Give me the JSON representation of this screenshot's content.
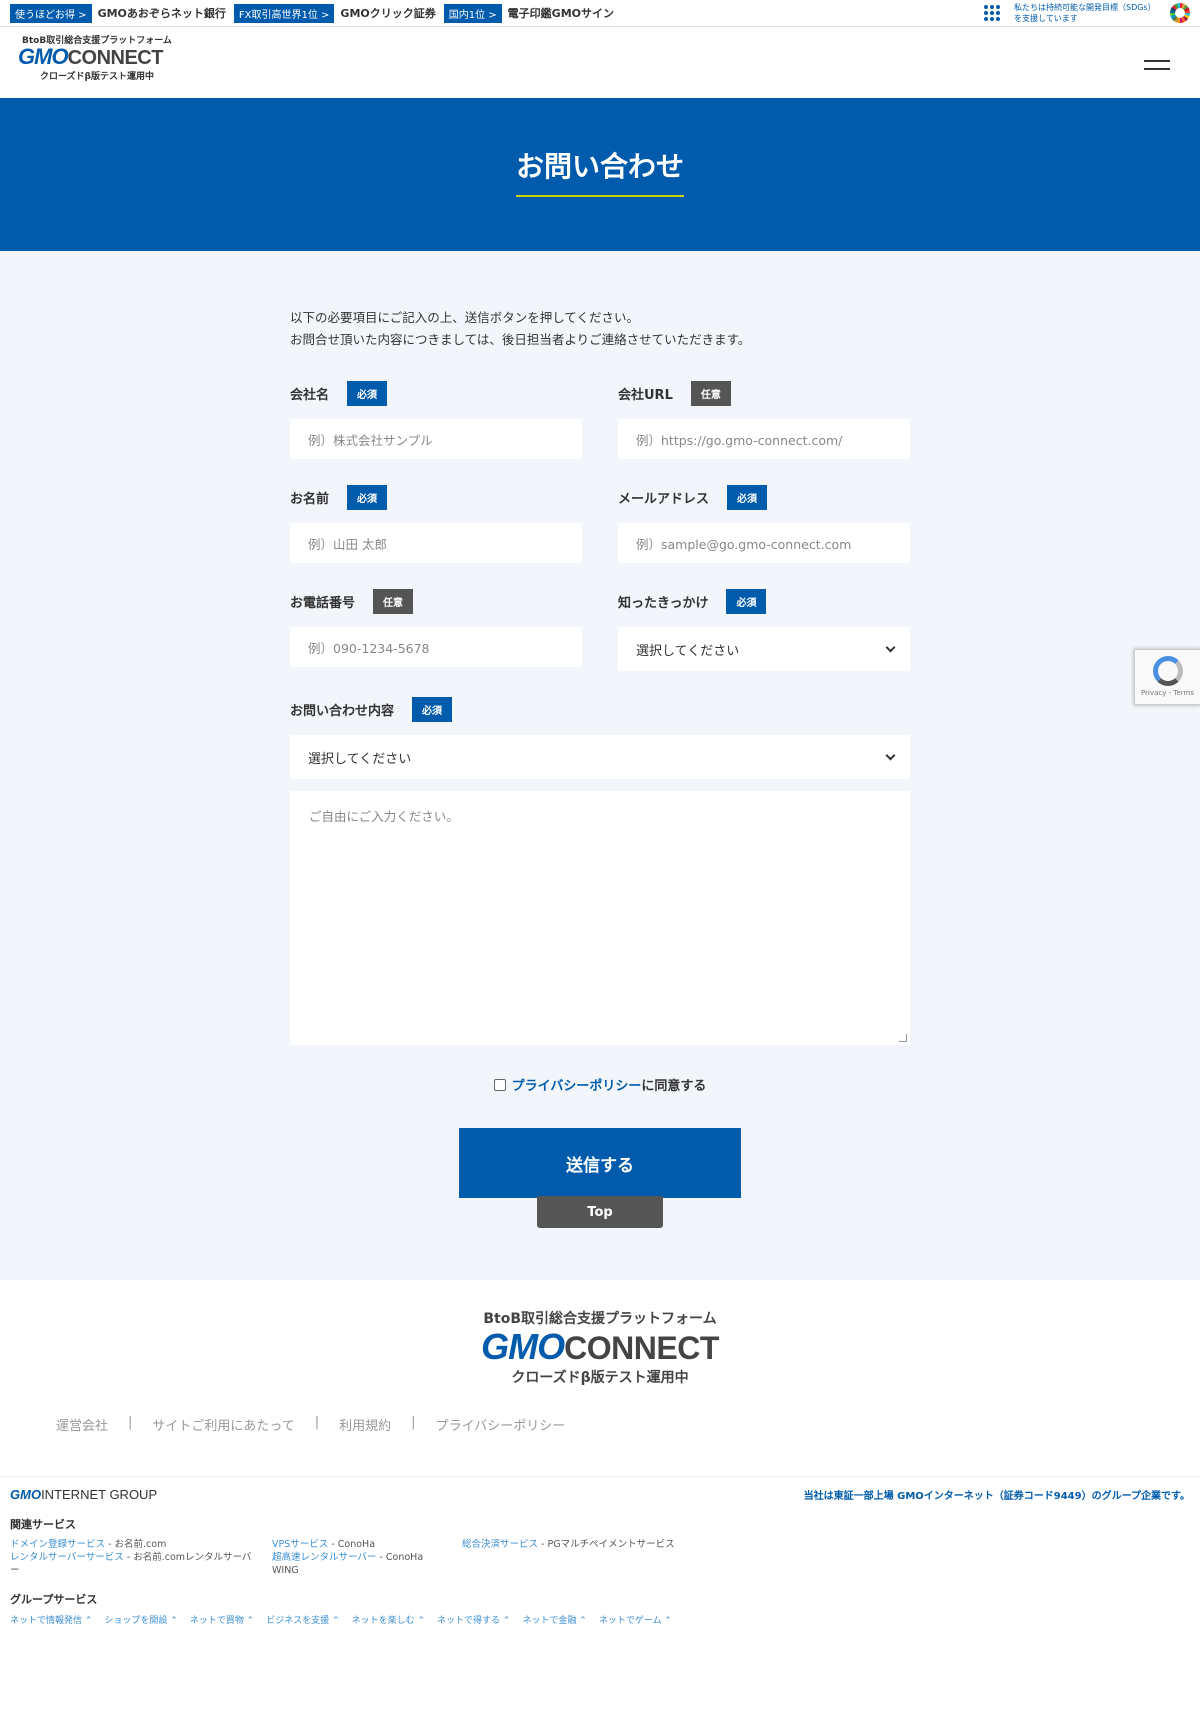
{
  "topbar": {
    "items": [
      {
        "badge": "使うほどお得 >",
        "text": "GMOあおぞらネット銀行"
      },
      {
        "badge": "FX取引高世界1位 >",
        "text": "GMOクリック証券"
      },
      {
        "badge": "国内1位 >",
        "text": "電子印鑑GMOサイン"
      }
    ],
    "sdgs_line1": "私たちは持続可能な開発目標（SDGs）",
    "sdgs_line2": "を支援しています"
  },
  "header": {
    "logo_tagline": "BtoB取引総合支援プラットフォーム",
    "logo_gmo": "GMO",
    "logo_connect": "CONNECT",
    "logo_sub": "クローズドβ版テスト運用中"
  },
  "hero": {
    "title": "お問い合わせ"
  },
  "form": {
    "intro_line1": "以下の必要項目にご記入の上、送信ボタンを押してください。",
    "intro_line2": "お問合せ頂いた内容につきましては、後日担当者よりご連絡させていただきます。",
    "required": "必須",
    "optional": "任意",
    "company_label": "会社名",
    "company_placeholder": "例）株式会社サンプル",
    "url_label": "会社URL",
    "url_placeholder": "例）https://go.gmo-connect.com/",
    "name_label": "お名前",
    "name_placeholder": "例）山田 太郎",
    "email_label": "メールアドレス",
    "email_placeholder": "例）sample@go.gmo-connect.com",
    "phone_label": "お電話番号",
    "phone_placeholder": "例）090-1234-5678",
    "source_label": "知ったきっかけ",
    "source_value": "選択してください",
    "inquiry_label": "お問い合わせ内容",
    "inquiry_value": "選択してください",
    "message_placeholder": "ご自由にご入力ください。",
    "agree_link": "プライバシーポリシー",
    "agree_text": "に同意する",
    "submit": "送信する",
    "top": "Top",
    "recaptcha": "Privacy - Terms"
  },
  "footer": {
    "tagline": "BtoB取引総合支援プラットフォーム",
    "logo_gmo": "GMO",
    "logo_connect": "CONNECT",
    "sub": "クローズドβ版テスト運用中",
    "links": [
      "運営会社",
      "サイトご利用にあたって",
      "利用規約",
      "プライバシーポリシー"
    ]
  },
  "group": {
    "logo_gmo": "GMO",
    "logo_text": "INTERNET GROUP",
    "note": "当社は東証一部上場 GMOインターネット（証券コード9449）のグループ企業です。",
    "related_title": "関連サービス",
    "col1_link1": "ドメイン登録サービス",
    "col1_name1": "お名前.com",
    "col1_link2": "レンタルサーバーサービス",
    "col1_name2": "お名前.comレンタルサーバー",
    "col2_link1": "VPSサービス",
    "col2_name1": "ConoHa",
    "col2_link2": "超高速レンタルサーバー",
    "col2_name2": "ConoHa WING",
    "col3_link1": "総合決済サービス",
    "col3_name1": "PGマルチペイメントサービス",
    "group_title": "グループサービス",
    "group_items": [
      "ネットで情報発信 ⌃",
      "ショップを開設 ⌃",
      "ネットで買物 ⌃",
      "ビジネスを支援 ⌃",
      "ネットを楽しむ ⌃",
      "ネットで得する ⌃",
      "ネットで金融 ⌃",
      "ネットでゲーム ⌃"
    ]
  }
}
